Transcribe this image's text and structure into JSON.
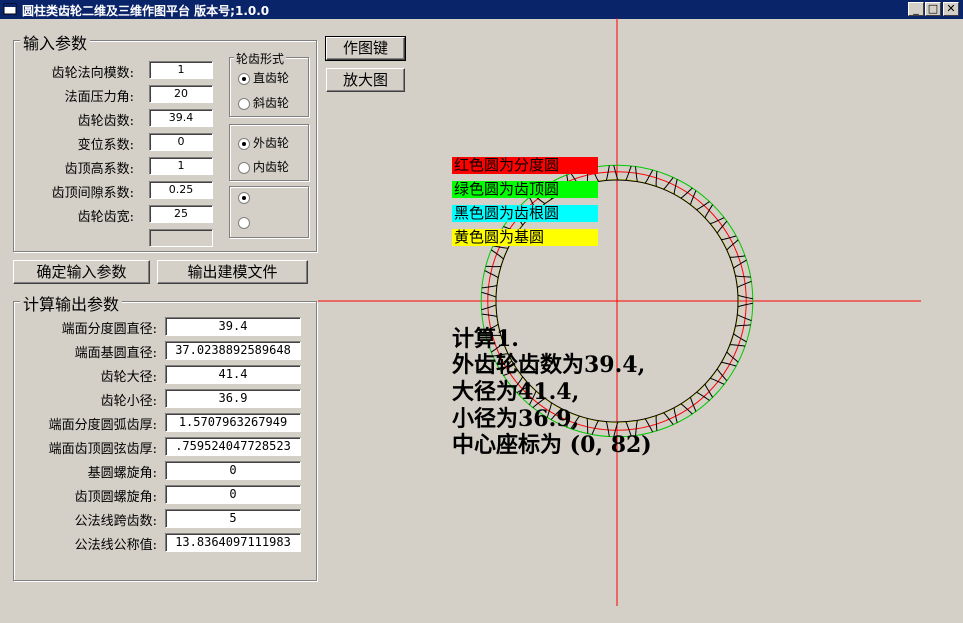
{
  "window": {
    "title": "圆柱类齿轮二维及三维作图平台 版本号;1.0.0",
    "buttons": [
      "_",
      "□",
      "✕"
    ]
  },
  "input_group": {
    "title": "输入参数",
    "fields": [
      {
        "label": "齿轮法向模数:",
        "value": "1"
      },
      {
        "label": "法面压力角:",
        "value": "20"
      },
      {
        "label": "齿轮齿数:",
        "value": "39.4"
      },
      {
        "label": "变位系数:",
        "value": "0"
      },
      {
        "label": "齿顶高系数:",
        "value": "1"
      },
      {
        "label": "齿顶间隙系数:",
        "value": "0.25"
      },
      {
        "label": "齿轮齿宽:",
        "value": "25"
      }
    ],
    "extra_field_value": ""
  },
  "tooth_form": {
    "title": "轮齿形式",
    "options": [
      {
        "label": "直齿轮",
        "checked": true
      },
      {
        "label": "斜齿轮",
        "checked": false
      }
    ]
  },
  "gear_type": {
    "options": [
      {
        "label": "外齿轮",
        "checked": true
      },
      {
        "label": "内齿轮",
        "checked": false
      }
    ]
  },
  "third_radio": {
    "options": [
      {
        "label": "",
        "checked": true
      },
      {
        "label": "",
        "checked": false
      }
    ]
  },
  "buttons": {
    "confirm": "确定输入参数",
    "export": "输出建模文件",
    "draw": "作图键",
    "zoom": "放大图"
  },
  "output_group": {
    "title": "计算输出参数",
    "fields": [
      {
        "label": "端面分度圆直径:",
        "value": "39.4"
      },
      {
        "label": "端面基圆直径:",
        "value": "37.0238892589648"
      },
      {
        "label": "齿轮大径:",
        "value": "41.4"
      },
      {
        "label": "齿轮小径:",
        "value": "36.9"
      },
      {
        "label": "端面分度圆弧齿厚:",
        "value": "1.5707963267949"
      },
      {
        "label": "端面齿顶圆弦齿厚:",
        "value": ".759524047728523"
      },
      {
        "label": "基圆螺旋角:",
        "value": "0"
      },
      {
        "label": "齿顶圆螺旋角:",
        "value": "0"
      },
      {
        "label": "公法线跨齿数:",
        "value": "5"
      },
      {
        "label": "公法线公称值:",
        "value": "13.8364097111983"
      }
    ]
  },
  "legend": [
    {
      "text": "红色圆为分度圆",
      "bg": "#ff0000",
      "color": "#000000"
    },
    {
      "text": "绿色圆为齿顶圆",
      "bg": "#00ff00",
      "color": "#000000"
    },
    {
      "text": "黑色圆为齿根圆",
      "bg": "#00ffff",
      "color": "#000000"
    },
    {
      "text": "黄色圆为基圆",
      "bg": "#ffff00",
      "color": "#000000"
    }
  ],
  "calc_text": [
    "计算1.",
    "外齿轮齿数为39.4,",
    "大径为41.4,",
    "小径为36.9,",
    "中心座标为 (0, 82)"
  ],
  "gear_drawing": {
    "teeth": 39.4,
    "pitch_color": "#ff0000",
    "tip_color": "#00c800",
    "root_color": "#000000",
    "base_color": "#d8d800",
    "axis_color": "#ff0000",
    "profile_color": "#000000"
  },
  "icons": {
    "app": "app-window-icon"
  }
}
